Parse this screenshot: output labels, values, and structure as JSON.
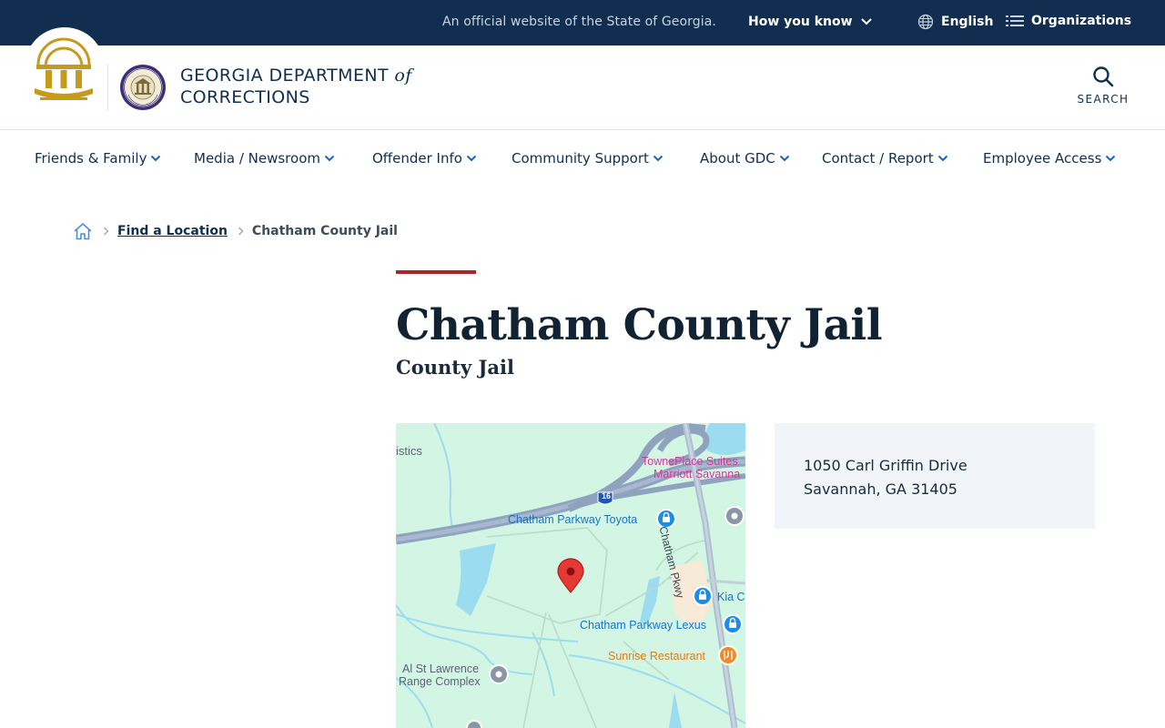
{
  "topbar": {
    "official_text": "An official website of the State of Georgia.",
    "how_you_know": "How you know",
    "language": "English",
    "organizations": "Organizations"
  },
  "header": {
    "brand_line1": "GEORGIA DEPARTMENT",
    "brand_of": "of",
    "brand_line2": "CORRECTIONS",
    "search_label": "SEARCH"
  },
  "nav": {
    "items": [
      {
        "label": "Friends & Family"
      },
      {
        "label": "Media / Newsroom"
      },
      {
        "label": "Offender Info"
      },
      {
        "label": "Community Support"
      },
      {
        "label": "About GDC"
      },
      {
        "label": "Contact / Report"
      },
      {
        "label": "Employee Access"
      }
    ]
  },
  "breadcrumb": {
    "parent": "Find a Location",
    "current": "Chatham County Jail"
  },
  "page": {
    "title": "Chatham County Jail",
    "subtitle": "County Jail"
  },
  "map": {
    "labels": {
      "logistics": "istics",
      "towneplace_1": "TownePlace Suites",
      "towneplace_2": "Marriott Savanna",
      "highway": "16",
      "chatham_pkwy": "Chatham Pkwy",
      "toyota": "Chatham Parkway Toyota",
      "kia": "Kia C",
      "lexus": "Chatham Parkway Lexus",
      "sunrise": "Sunrise Restaurant",
      "range_1": "Al St Lawrence",
      "range_2": "Range Complex"
    },
    "colors": {
      "land": "#d3f5e3",
      "road": "#8fa3bf",
      "water": "#9cdcf0",
      "pin": "#e53935",
      "poi_blue": "#1a8ee6",
      "poi_orange": "#f08a24",
      "poi_pink": "#d6389a"
    }
  },
  "address": {
    "line1": "1050 Carl Griffin Drive",
    "line2": "Savannah, GA 31405"
  },
  "colors": {
    "navy": "#112e51",
    "accent_red": "#a9262d",
    "card_bg": "#f1f5f9"
  }
}
